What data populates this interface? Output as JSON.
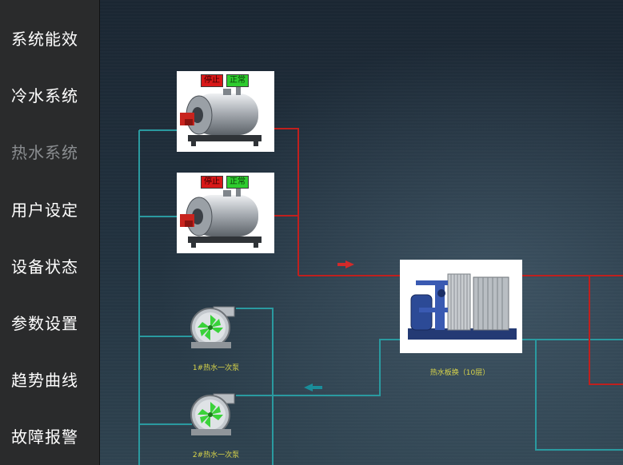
{
  "nav": {
    "items": [
      {
        "label": "系统能效",
        "active": false
      },
      {
        "label": "冷水系统",
        "active": false
      },
      {
        "label": "热水系统",
        "active": true
      },
      {
        "label": "用户设定",
        "active": false
      },
      {
        "label": "设备状态",
        "active": false
      },
      {
        "label": "参数设置",
        "active": false
      },
      {
        "label": "趋势曲线",
        "active": false
      },
      {
        "label": "故障报警",
        "active": false
      }
    ]
  },
  "colors": {
    "hot_pipe": "#c0201e",
    "return_pipe": "#2a9aa0",
    "badge_stop": "#d81818",
    "badge_ok": "#2ecc2e",
    "caption": "#d8d44a"
  },
  "boilers": [
    {
      "stop_label": "停止",
      "status_label": "正常",
      "icon": "boiler-icon"
    },
    {
      "stop_label": "停止",
      "status_label": "正常",
      "icon": "boiler-icon"
    }
  ],
  "pumps": [
    {
      "caption": "1#热水一次泵",
      "icon": "pump-icon"
    },
    {
      "caption": "2#热水一次泵",
      "icon": "pump-icon"
    }
  ],
  "exchanger": {
    "caption": "热水板换（10层）",
    "icon": "plate-heat-exchanger-icon"
  },
  "flow_arrows": [
    {
      "direction": "right",
      "icon": "flow-arrow-right-icon",
      "color": "#d32a2a"
    },
    {
      "direction": "left",
      "icon": "flow-arrow-left-icon",
      "color": "#1a8d9a"
    }
  ]
}
